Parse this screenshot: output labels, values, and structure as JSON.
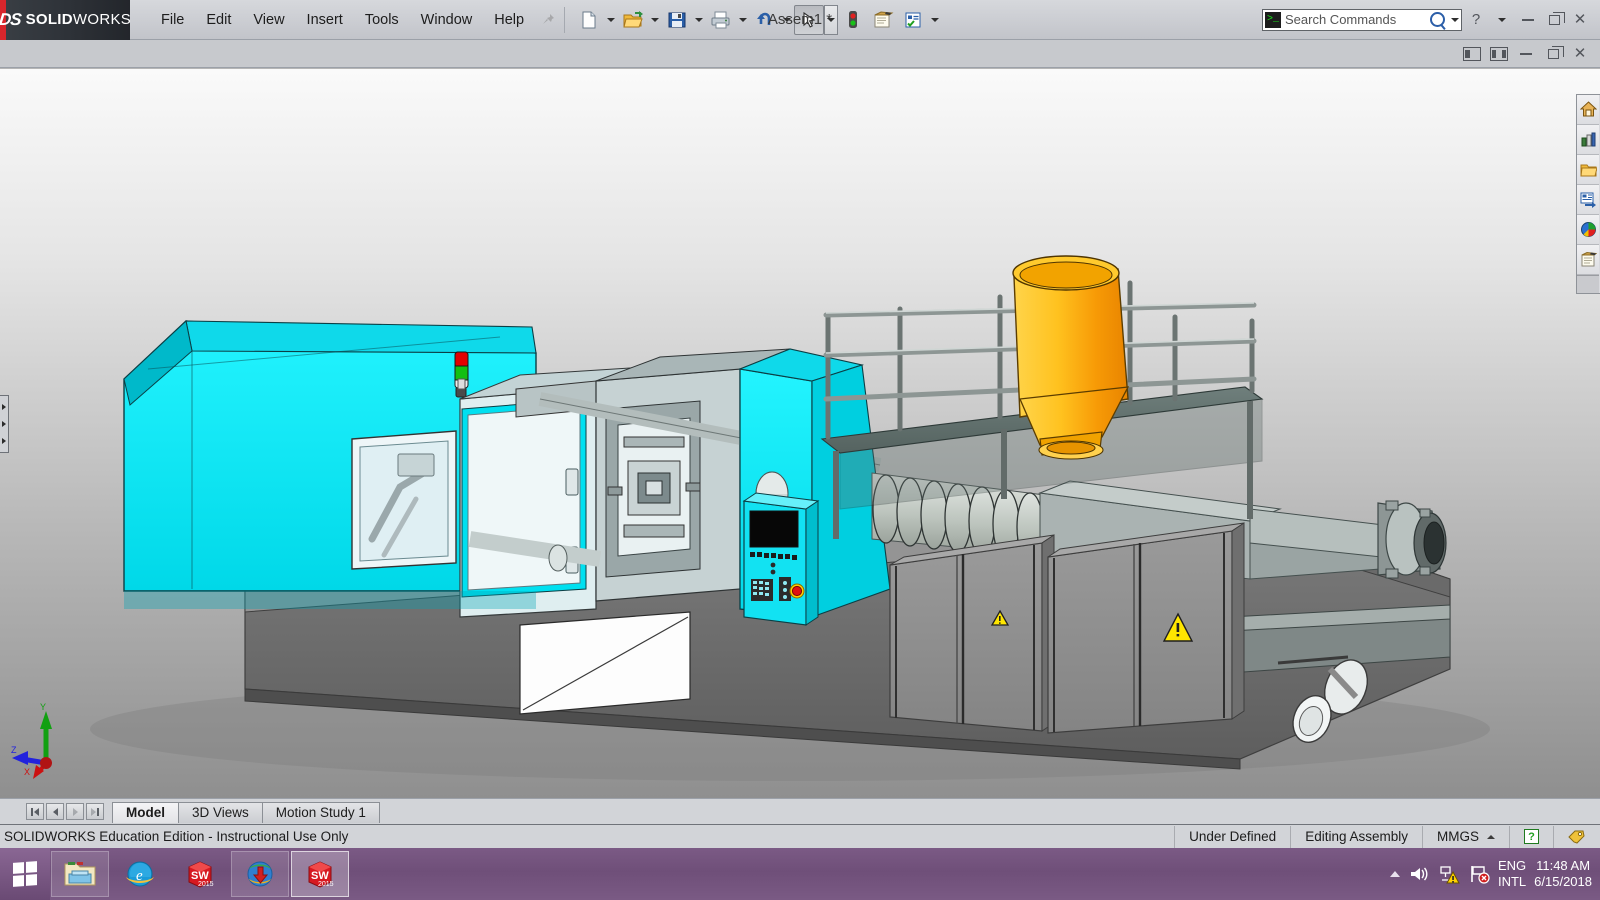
{
  "app": {
    "brand_ds": "DS",
    "brand_bold": "SOLID",
    "brand_thin": "WORKS",
    "document_title": "Assem1 *"
  },
  "menubar": {
    "items": [
      {
        "label": "File",
        "name": "menu-file"
      },
      {
        "label": "Edit",
        "name": "menu-edit"
      },
      {
        "label": "View",
        "name": "menu-view"
      },
      {
        "label": "Insert",
        "name": "menu-insert"
      },
      {
        "label": "Tools",
        "name": "menu-tools"
      },
      {
        "label": "Window",
        "name": "menu-window"
      },
      {
        "label": "Help",
        "name": "menu-help"
      }
    ],
    "pin_icon": "pushpin-icon"
  },
  "toolbar": {
    "buttons": [
      {
        "name": "new-document-button",
        "icon": "new-document-icon",
        "tooltip": "New"
      },
      {
        "name": "open-document-button",
        "icon": "open-folder-icon",
        "tooltip": "Open"
      },
      {
        "name": "save-button",
        "icon": "save-floppy-icon",
        "tooltip": "Save"
      },
      {
        "name": "print-button",
        "icon": "printer-icon",
        "tooltip": "Print"
      },
      {
        "name": "undo-button",
        "icon": "undo-arrow-icon",
        "tooltip": "Undo"
      },
      {
        "name": "select-tool-button",
        "icon": "select-arrow-icon",
        "tooltip": "Select"
      },
      {
        "name": "rebuild-button",
        "icon": "traffic-light-icon",
        "tooltip": "Rebuild"
      },
      {
        "name": "options-button",
        "icon": "options-notepad-icon",
        "tooltip": "Options"
      },
      {
        "name": "appearance-button",
        "icon": "checklist-icon",
        "tooltip": "Edit Appearance"
      }
    ]
  },
  "search": {
    "placeholder": "Search Commands",
    "prompt_glyph": ">_",
    "icon": "magnifier-icon"
  },
  "window_controls": {
    "help": "?",
    "minimize": "minimize-icon",
    "restore": "restore-icon",
    "close": "✕"
  },
  "doc_window_controls": {
    "collapse_left": "panel-collapse-left-icon",
    "collapse_right": "panel-collapse-right-icon",
    "minimize": "minimize-icon",
    "restore": "restore-icon",
    "close": "✕"
  },
  "task_pane": {
    "items": [
      {
        "name": "taskpane-home",
        "icon": "sw-resources-home-icon"
      },
      {
        "name": "taskpane-design-library",
        "icon": "design-library-icon"
      },
      {
        "name": "taskpane-file-explorer",
        "icon": "file-explorer-folder-icon"
      },
      {
        "name": "taskpane-view-palette",
        "icon": "view-palette-icon"
      },
      {
        "name": "taskpane-appearances",
        "icon": "appearances-scenes-color-ball-icon"
      },
      {
        "name": "taskpane-custom-properties",
        "icon": "custom-properties-icon"
      }
    ]
  },
  "left_flyout": {
    "name": "feature-manager-flyout-handle",
    "icon": "expand-arrows-icon"
  },
  "tabs": {
    "nav": [
      {
        "name": "tab-nav-first",
        "icon": "first-icon"
      },
      {
        "name": "tab-nav-prev",
        "icon": "previous-icon"
      },
      {
        "name": "tab-nav-next",
        "icon": "next-icon"
      },
      {
        "name": "tab-nav-last",
        "icon": "last-icon"
      }
    ],
    "items": [
      {
        "label": "Model",
        "name": "tab-model",
        "active": true
      },
      {
        "label": "3D Views",
        "name": "tab-3d-views",
        "active": false
      },
      {
        "label": "Motion Study 1",
        "name": "tab-motion-study-1",
        "active": false
      }
    ]
  },
  "statusbar": {
    "license": "SOLIDWORKS Education Edition - Instructional Use Only",
    "state": "Under Defined",
    "mode": "Editing Assembly",
    "units": "MMGS",
    "help_glyph": "?"
  },
  "taskbar": {
    "start": {
      "name": "start-button",
      "icon": "windows-logo-icon"
    },
    "apps": [
      {
        "name": "taskbar-file-explorer",
        "icon": "file-explorer-icon",
        "label": "File Explorer",
        "state": "open"
      },
      {
        "name": "taskbar-internet-explorer",
        "icon": "internet-explorer-icon",
        "label": "Internet Explorer",
        "state": "idle"
      },
      {
        "name": "taskbar-solidworks",
        "icon": "solidworks-2015-cube-icon",
        "label": "SW 2015",
        "state": "idle"
      },
      {
        "name": "taskbar-download-manager",
        "icon": "download-manager-icon",
        "label": "Internet Download Manager",
        "state": "open"
      },
      {
        "name": "taskbar-solidworks-active",
        "icon": "solidworks-2015-cube-icon",
        "label": "SW 2015",
        "state": "active"
      }
    ],
    "tray": {
      "show_hidden": "show-hidden-icons-icon",
      "volume": "volume-icon",
      "network": "network-warning-icon",
      "action_center": "action-center-flag-icon",
      "lang_line1": "ENG",
      "lang_line2": "INTL",
      "time": "11:48 AM",
      "date": "6/15/2018"
    }
  },
  "viewport": {
    "model_name": "injection-molding-machine",
    "triad": {
      "x": "X",
      "y": "Y",
      "z": "Z"
    },
    "colors": {
      "clamp_housing_cyan": "#00e5f0",
      "base_frame_gray": "#6e6e6e",
      "cabinet_gray": "#8c8c8c",
      "metal_light": "#c9cfcb",
      "hopper_orange": "#f5a800",
      "warning_yellow": "#ffe600",
      "signal_red": "#e00000",
      "signal_green": "#00c000",
      "screen_black": "#0a0a0a"
    }
  }
}
